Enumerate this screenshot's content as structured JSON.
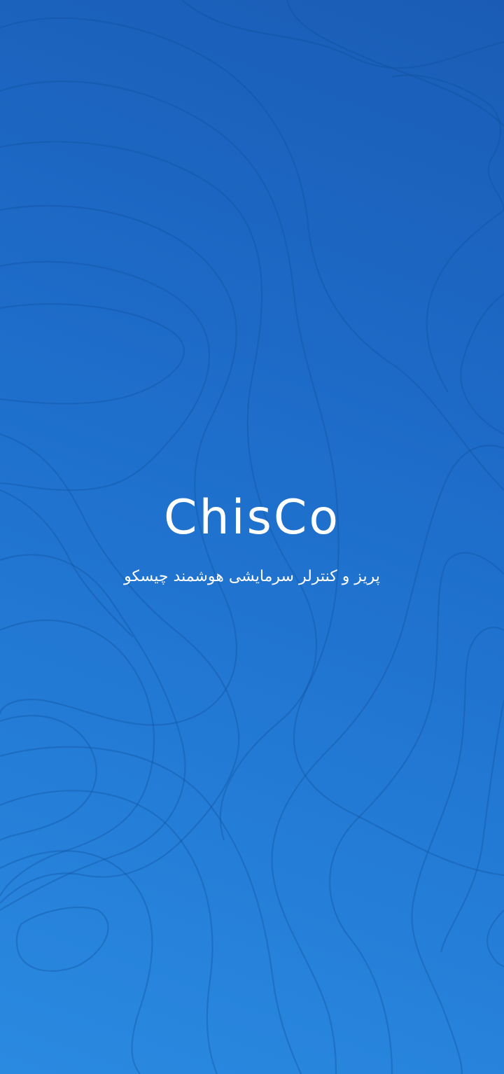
{
  "splash": {
    "logo_text": "ChisCo",
    "tagline": "پریز و کنترلر سرمایشی هوشمند چیسکو"
  },
  "colors": {
    "background_top": "#1a5cb5",
    "background_bottom": "#2a8ae0",
    "text": "#ffffff",
    "contour_lines": "#0f4f9e"
  }
}
